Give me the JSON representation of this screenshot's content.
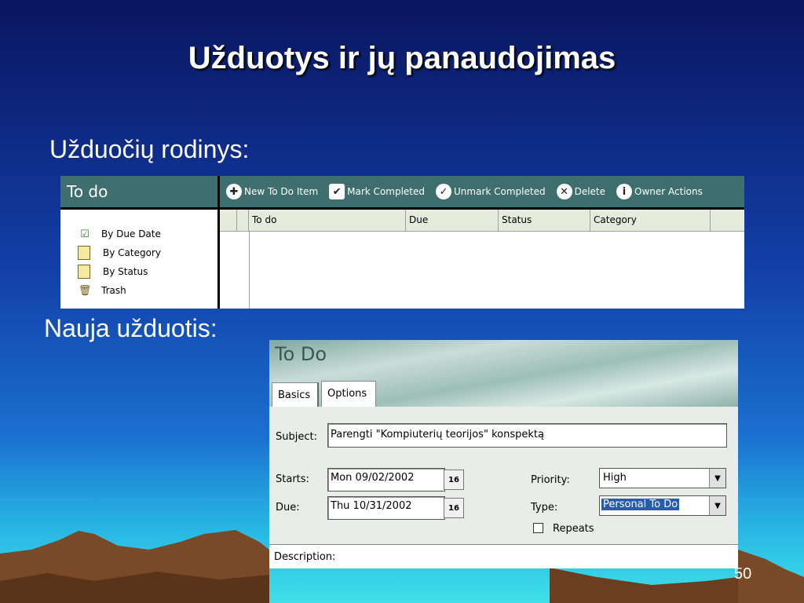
{
  "slide": {
    "title": "Užduotys ir jų panaudojimas",
    "label_view": "Užduočių rodinys:",
    "label_new": "Nauja užduotis:",
    "page_number": "50"
  },
  "todo_view": {
    "header": "To do",
    "toolbar": [
      {
        "label": "New To Do Item",
        "icon": "new-item-icon"
      },
      {
        "label": "Mark Completed",
        "icon": "checkmark-icon"
      },
      {
        "label": "Unmark Completed",
        "icon": "uncheck-icon"
      },
      {
        "label": "Delete",
        "icon": "delete-icon"
      },
      {
        "label": "Owner Actions",
        "icon": "info-icon"
      }
    ],
    "nav": [
      {
        "label": "By Due Date",
        "icon": "checked-list-icon"
      },
      {
        "label": "By Category",
        "icon": "list-icon"
      },
      {
        "label": "By Status",
        "icon": "list-icon"
      },
      {
        "label": "Trash",
        "icon": "trash-icon"
      }
    ],
    "columns": [
      "To do",
      "Due",
      "Status",
      "Category"
    ]
  },
  "dialog": {
    "title": "To Do",
    "tabs": [
      "Basics",
      "Options"
    ],
    "subject_label": "Subject:",
    "subject_value": "Parengti  \"Kompiuterių teorijos\" konspektą",
    "starts_label": "Starts:",
    "starts_value": "Mon 09/02/2002",
    "due_label": "Due:",
    "due_value": "Thu 10/31/2002",
    "calendar_label": "16",
    "priority_label": "Priority:",
    "priority_value": "High",
    "type_label": "Type:",
    "type_value": "Personal To Do",
    "repeats_label": "Repeats",
    "description_label": "Description:"
  },
  "colors": {
    "bg_top": "#0b1a66",
    "bg_mid": "#1548b8",
    "bg_bottom": "#29c0e6",
    "header_teal": "#3f6e6e",
    "mountains": "#7a4a28"
  }
}
